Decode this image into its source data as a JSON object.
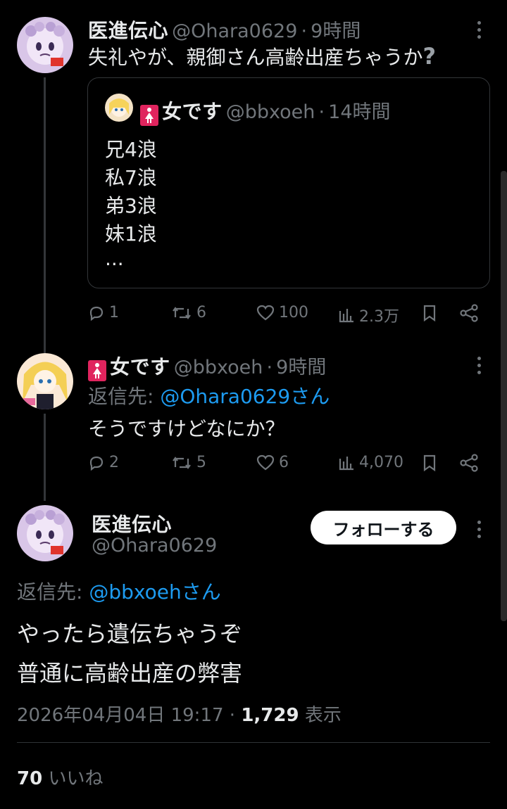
{
  "tweet1": {
    "name": "医進伝心",
    "handle": "@Ohara0629",
    "dot": "·",
    "time": "9時間",
    "text": "失礼やが、親御さん高齢出産ちゃうか",
    "question_mark": "?",
    "quote": {
      "name": "女です",
      "handle": "@bbxoeh",
      "dot": "·",
      "time": "14時間",
      "lines": [
        "兄4浪",
        "私7浪",
        "弟3浪",
        "妹1浪",
        "..."
      ]
    },
    "actions": {
      "replies": "1",
      "retweets": "6",
      "likes": "100",
      "views": "2.3万"
    }
  },
  "tweet2": {
    "name": "女です",
    "handle": "@bbxoeh",
    "dot": "·",
    "time": "9時間",
    "reply_prefix": "返信先: ",
    "reply_to": "@Ohara0629さん",
    "text": "そうですけどなにか？",
    "actions": {
      "replies": "2",
      "retweets": "5",
      "likes": "6",
      "views": "4,070"
    }
  },
  "main": {
    "name": "医進伝心",
    "handle": "@Ohara0629",
    "follow_label": "フォローする",
    "reply_prefix": "返信先: ",
    "reply_to": "@bbxoehさん",
    "line1": "やったら遺伝ちゃうぞ",
    "line2": "普通に高齢出産の弊害",
    "timestamp": "2026年04月04日 19:17",
    "dot": "·",
    "views_count": "1,729",
    "views_label": "表示",
    "likes_count": "70",
    "likes_label": "いいね"
  },
  "colors": {
    "background": "#000000",
    "text": "#e7e9ea",
    "muted": "#71767b",
    "link": "#1d9bf0",
    "badge": "#e0245e"
  }
}
